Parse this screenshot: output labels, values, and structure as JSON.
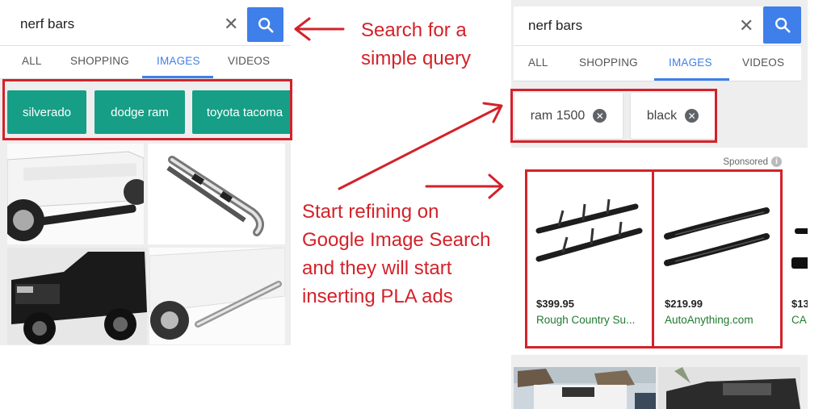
{
  "left": {
    "search": {
      "query": "nerf bars"
    },
    "tabs": [
      "ALL",
      "SHOPPING",
      "IMAGES",
      "VIDEOS"
    ],
    "active_tab": "IMAGES",
    "suggestion_chips": [
      "silverado",
      "dodge ram",
      "toyota tacoma"
    ]
  },
  "right": {
    "search": {
      "query": "nerf bars"
    },
    "tabs": [
      "ALL",
      "SHOPPING",
      "IMAGES",
      "VIDEOS"
    ],
    "active_tab": "IMAGES",
    "refine_chips": [
      "ram 1500",
      "black"
    ],
    "sponsored_label": "Sponsored",
    "ads": [
      {
        "price": "$399.95",
        "seller": "Rough Country Su..."
      },
      {
        "price": "$219.99",
        "seller": "AutoAnything.com"
      },
      {
        "price": "$13",
        "seller": "CA"
      }
    ]
  },
  "annotations": {
    "top_lines": [
      "Search for a",
      "simple query"
    ],
    "middle_lines": [
      "Start refining on",
      "Google Image Search",
      "and they will start",
      "inserting PLA ads"
    ]
  },
  "colors": {
    "annotation_red": "#d3222a",
    "chip_teal": "#179e86",
    "google_blue": "#3f7fe9",
    "seller_green": "#1f7a2e"
  },
  "icons": [
    "search-icon",
    "clear-icon",
    "close-circle-icon",
    "info-icon",
    "arrow-icon"
  ]
}
